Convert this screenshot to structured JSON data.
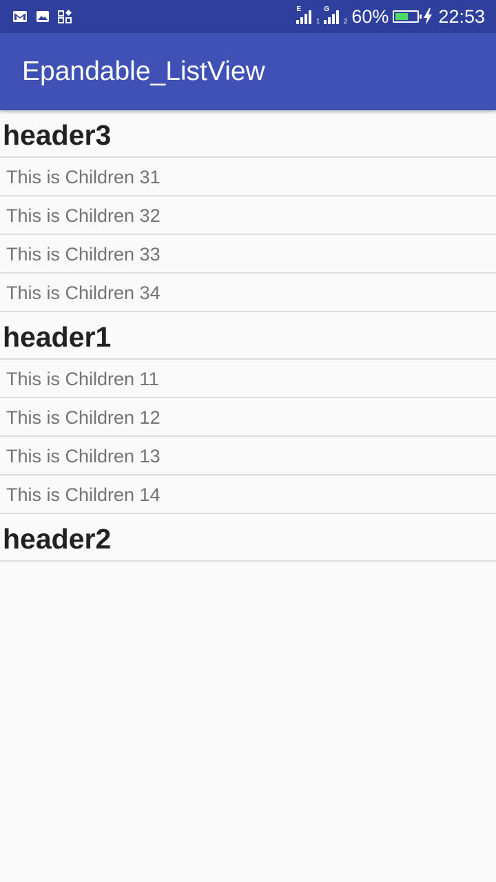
{
  "status_bar": {
    "icons_left": [
      "gmail-icon",
      "gallery-icon",
      "apps-icon"
    ],
    "sim1_network": "E",
    "sim1_slot": "1",
    "sim2_network": "G",
    "sim2_slot": "2",
    "battery_percent": "60%",
    "battery_level": 0.6,
    "charging": true,
    "time": "22:53",
    "colors": {
      "background": "#2f3f9e",
      "battery_fill": "#4cd964"
    }
  },
  "app_bar": {
    "title": "Epandable_ListView",
    "color": "#3f51b5"
  },
  "groups": [
    {
      "header": "header3",
      "children": [
        "This is Children 31",
        "This is Children 32",
        "This is Children 33",
        "This is Children 34"
      ]
    },
    {
      "header": "header1",
      "children": [
        "This is Children 11",
        "This is Children 12",
        "This is Children 13",
        "This is Children 14"
      ]
    },
    {
      "header": "header2",
      "children": []
    }
  ]
}
